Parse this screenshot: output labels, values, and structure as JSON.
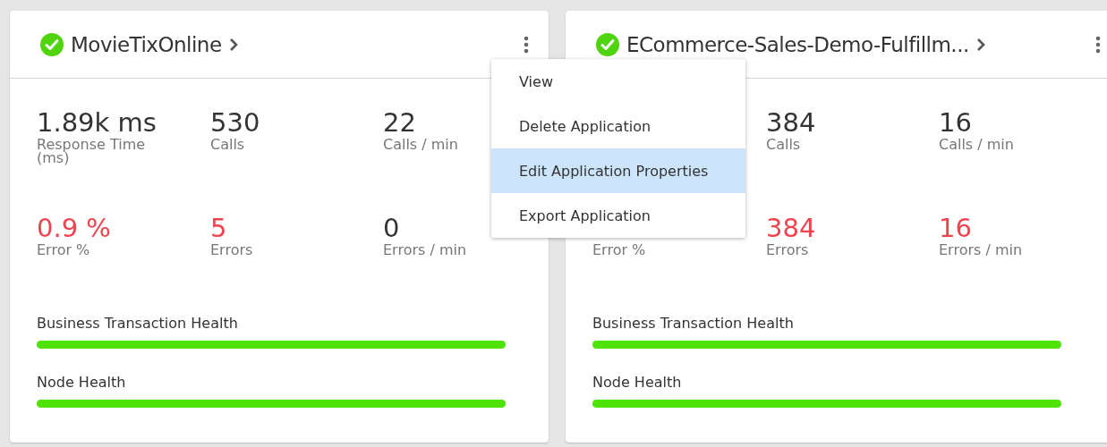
{
  "cards": [
    {
      "title": "MovieTixOnline",
      "healthy": true,
      "rows": [
        [
          {
            "value": "1.89k ms",
            "label": "Response Time (ms)",
            "alert": false
          },
          {
            "value": "530",
            "label": "Calls",
            "alert": false
          },
          {
            "value": "22",
            "label": "Calls / min",
            "alert": false
          }
        ],
        [
          {
            "value": "0.9 %",
            "label": "Error %",
            "alert": true
          },
          {
            "value": "5",
            "label": "Errors",
            "alert": true
          },
          {
            "value": "0",
            "label": "Errors / min",
            "alert": false
          }
        ]
      ],
      "health": [
        {
          "label": "Business Transaction Health",
          "level": 1
        },
        {
          "label": "Node Health",
          "level": 1
        }
      ]
    },
    {
      "title": "ECommerce-Sales-Demo-Fulfillm...",
      "healthy": true,
      "rows": [
        [
          "",
          {
            "value": "384",
            "label": "Calls",
            "alert": false
          },
          {
            "value": "16",
            "label": "Calls / min",
            "alert": false
          }
        ],
        [
          {
            "label": "Error %"
          },
          {
            "value": "384",
            "label": "Errors",
            "alert": true
          },
          {
            "value": "16",
            "label": "Errors / min",
            "alert": true
          }
        ]
      ],
      "health": [
        {
          "label": "Business Transaction Health",
          "level": 1
        },
        {
          "label": "Node Health",
          "level": 1
        }
      ]
    }
  ],
  "menu": {
    "items": [
      {
        "label": "View",
        "selected": false
      },
      {
        "label": "Delete Application",
        "selected": false
      },
      {
        "label": "Edit Application Properties",
        "selected": true
      },
      {
        "label": "Export Application",
        "selected": false
      }
    ]
  }
}
